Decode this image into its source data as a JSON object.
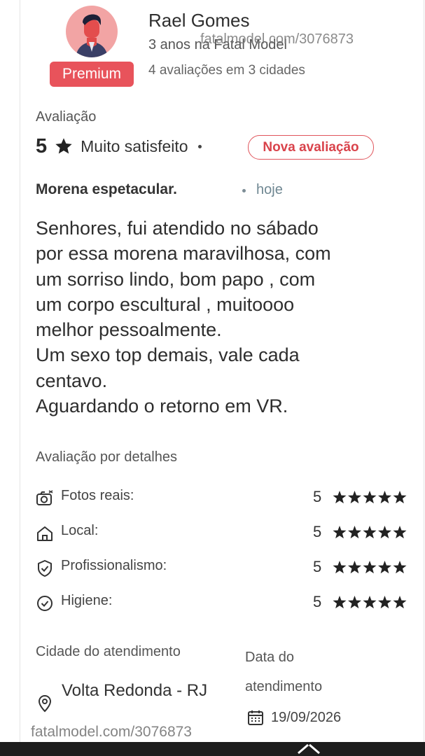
{
  "reviewer": {
    "name": "Rael Gomes",
    "since": "3 anos na Fatal Model",
    "reviews_count": "4 avaliações em 3 cidades",
    "badge": "Premium",
    "avatar": "person-icon"
  },
  "watermark": {
    "top": "fatalmodel.com/3076873",
    "bottom": "fatalmodel.com/3076873"
  },
  "rating": {
    "label": "Avaliação",
    "value": "5",
    "icon": "star-icon",
    "text": "Muito satisfeito",
    "badge": "Nova avaliação"
  },
  "review": {
    "title": "Morena espetacular.",
    "when": "hoje",
    "body_lines": [
      "Senhores, fui atendido no sábado",
      "por essa morena maravilhosa, com",
      "um sorriso lindo, bom papo , com",
      "um corpo escultural , muitoooo",
      "melhor pessoalmente.",
      "Um sexo top demais, vale cada",
      "centavo.",
      "Aguardando o retorno em VR."
    ]
  },
  "details": {
    "title": "Avaliação por detalhes",
    "items": [
      {
        "label": "Fotos reais:",
        "score": "5",
        "stars": 5,
        "icon": "camera-icon"
      },
      {
        "label": "Local:",
        "score": "5",
        "stars": 5,
        "icon": "home-icon"
      },
      {
        "label": "Profissionalismo:",
        "score": "5",
        "stars": 5,
        "icon": "shield-check-icon"
      },
      {
        "label": "Higiene:",
        "score": "5",
        "stars": 5,
        "icon": "check-circle-icon"
      }
    ]
  },
  "service": {
    "city_label": "Cidade do atendimento",
    "city_value": "Volta Redonda - RJ",
    "city_icon": "location-pin-icon",
    "date_label": "Data do atendimento",
    "date_value": "19/09/2026",
    "date_icon": "calendar-icon"
  },
  "colors": {
    "accent": "#e8535b",
    "avatar_bg": "#f2a4a4",
    "time_text": "#6f8792"
  }
}
